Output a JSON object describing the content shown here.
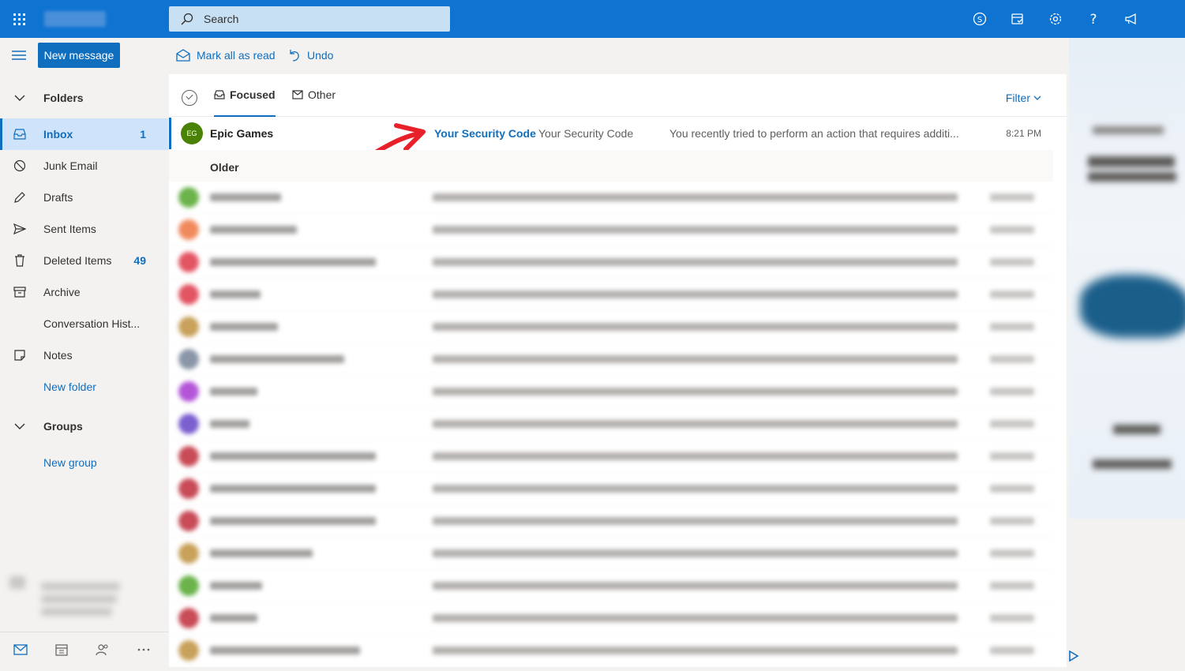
{
  "topbar": {
    "search_label": "Search"
  },
  "commands": {
    "new_message": "New message",
    "mark_all_read": "Mark all as read",
    "undo": "Undo"
  },
  "nav": {
    "folders_label": "Folders",
    "items": [
      {
        "label": "Inbox",
        "count": "1"
      },
      {
        "label": "Junk Email",
        "count": ""
      },
      {
        "label": "Drafts",
        "count": ""
      },
      {
        "label": "Sent Items",
        "count": ""
      },
      {
        "label": "Deleted Items",
        "count": "49"
      },
      {
        "label": "Archive",
        "count": ""
      },
      {
        "label": "Conversation Hist...",
        "count": ""
      },
      {
        "label": "Notes",
        "count": ""
      }
    ],
    "new_folder": "New folder",
    "groups_label": "Groups",
    "new_group": "New group"
  },
  "list": {
    "tabs": [
      {
        "label": "Focused"
      },
      {
        "label": "Other"
      }
    ],
    "filter": "Filter",
    "message": {
      "avatar": "EG",
      "sender": "Epic Games",
      "subject": "Your Security Code",
      "subject_repeat": "Your Security Code",
      "preview": "You recently tried to perform an action that requires additi...",
      "time": "8:21 PM"
    },
    "older_label": "Older"
  },
  "colors": {
    "accent": "#106ebe",
    "topbar": "#0f74d1",
    "annotation_arrow": "#e8202a"
  }
}
